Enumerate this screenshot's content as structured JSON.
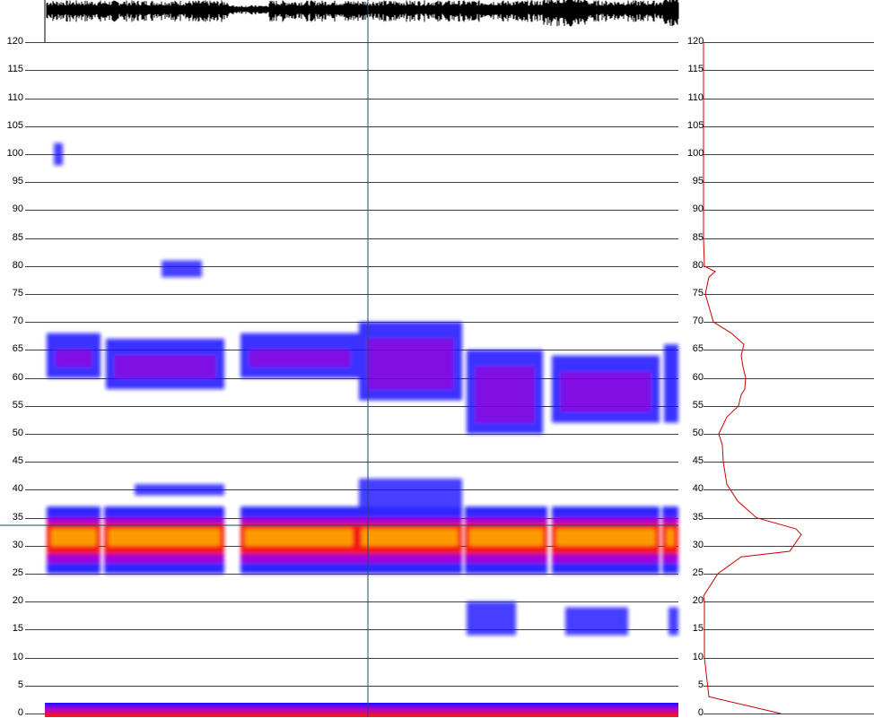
{
  "frequency_axis": {
    "ticks": [
      "120",
      "115",
      "110",
      "105",
      "100",
      "95",
      "90",
      "85",
      "80",
      "75",
      "70",
      "65",
      "60",
      "55",
      "50",
      "45",
      "40",
      "35",
      "30",
      "25",
      "20",
      "15",
      "10",
      "5",
      "0"
    ]
  },
  "colors": {
    "waveform": "#000000",
    "grid": "#000000",
    "cursor": "#1f4a6a",
    "spectrum_line": "#cc0000",
    "heat_low": "#1a10ff",
    "heat_mid": "#b000d0",
    "heat_high": "#ff1a00",
    "heat_peak": "#ffd400"
  },
  "icons": {
    "waveform": "audio-waveform",
    "cursor": "playhead-line"
  }
}
